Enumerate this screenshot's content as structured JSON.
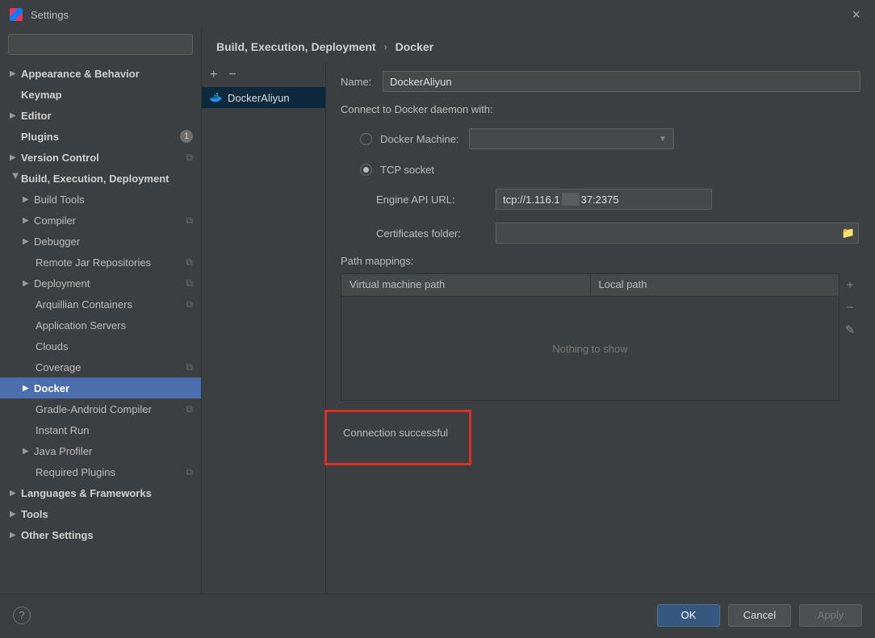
{
  "window": {
    "title": "Settings"
  },
  "search": {
    "placeholder": ""
  },
  "tree": {
    "appearance": "Appearance & Behavior",
    "keymap": "Keymap",
    "editor": "Editor",
    "plugins": "Plugins",
    "plugins_badge": "1",
    "version_control": "Version Control",
    "bed": "Build, Execution, Deployment",
    "build_tools": "Build Tools",
    "compiler": "Compiler",
    "debugger": "Debugger",
    "remote_jar": "Remote Jar Repositories",
    "deployment": "Deployment",
    "arquillian": "Arquillian Containers",
    "app_servers": "Application Servers",
    "clouds": "Clouds",
    "coverage": "Coverage",
    "docker": "Docker",
    "gradle_android": "Gradle-Android Compiler",
    "instant_run": "Instant Run",
    "java_profiler": "Java Profiler",
    "required_plugins": "Required Plugins",
    "languages": "Languages & Frameworks",
    "tools": "Tools",
    "other": "Other Settings"
  },
  "breadcrumb": {
    "a": "Build, Execution, Deployment",
    "b": "Docker"
  },
  "mid": {
    "item": "DockerAliyun"
  },
  "form": {
    "name_label": "Name:",
    "name_value": "DockerAliyun",
    "connect_label": "Connect to Docker daemon with:",
    "docker_machine": "Docker Machine:",
    "tcp_socket": "TCP socket",
    "engine_api_label": "Engine API URL:",
    "engine_api_prefix": "tcp://1.116.1",
    "engine_api_suffix": "37:2375",
    "cert_folder_label": "Certificates folder:",
    "path_mappings": "Path mappings:",
    "col_vm": "Virtual machine path",
    "col_local": "Local path",
    "empty": "Nothing to show",
    "status": "Connection successful"
  },
  "footer": {
    "ok": "OK",
    "cancel": "Cancel",
    "apply": "Apply"
  }
}
